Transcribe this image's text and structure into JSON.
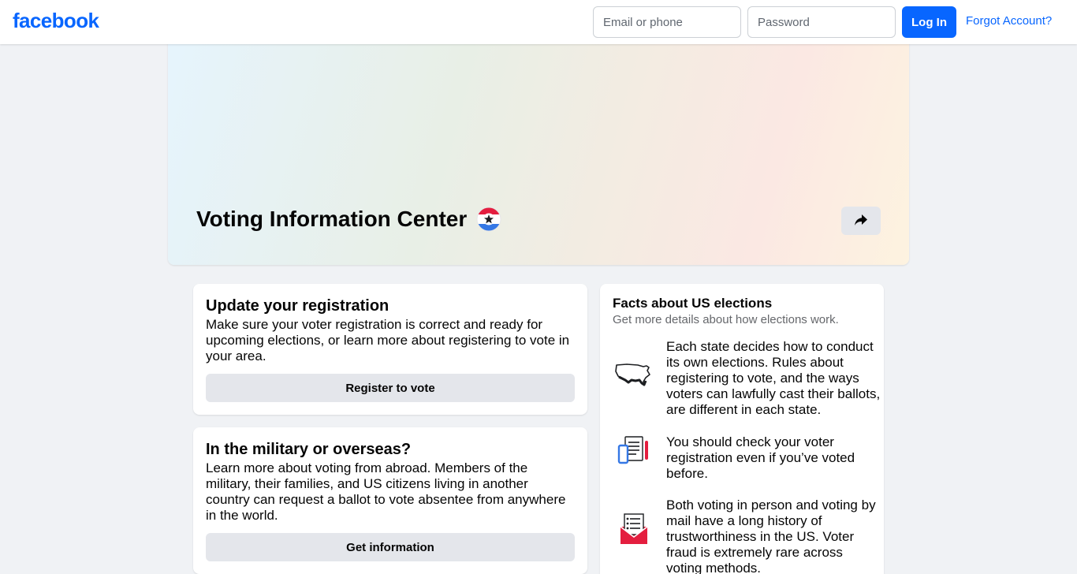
{
  "header": {
    "logo": "facebook",
    "email_placeholder": "Email or phone",
    "password_placeholder": "Password",
    "login_label": "Log In",
    "forgot_label": "Forgot Account?"
  },
  "hero": {
    "title": "Voting Information Center",
    "badge_icon": "vote-star-badge-icon",
    "share_icon": "share-arrow-icon"
  },
  "cards": [
    {
      "title": "Update your registration",
      "body": "Make sure your voter registration is correct and ready for upcoming elections, or learn more about registering to vote in your area.",
      "button": "Register to vote"
    },
    {
      "title": "In the military or overseas?",
      "body": "Learn more about voting from abroad. Members of the military, their families, and US citizens living in another country can request a ballot to vote absentee from anywhere in the world.",
      "button": "Get information"
    }
  ],
  "facts": {
    "title": "Facts about US elections",
    "subtitle": "Get more details about how elections work.",
    "items": [
      {
        "icon": "us-map-icon",
        "text": "Each state decides how to conduct its own elections. Rules about registering to vote, and the ways voters can lawfully cast their ballots, are different in each state."
      },
      {
        "icon": "phone-checklist-icon",
        "text": "You should check your voter registration even if you’ve voted before."
      },
      {
        "icon": "mail-ballot-icon",
        "text": "Both voting in person and voting by mail have a long history of trustworthiness in the US. Voter fraud is extremely rare across voting methods."
      }
    ]
  },
  "colors": {
    "brand": "#0866ff",
    "page_bg": "#f0f2f5",
    "button_gray": "#e4e6eb",
    "badge_red": "#e41e3f",
    "badge_blue": "#3578e5"
  }
}
